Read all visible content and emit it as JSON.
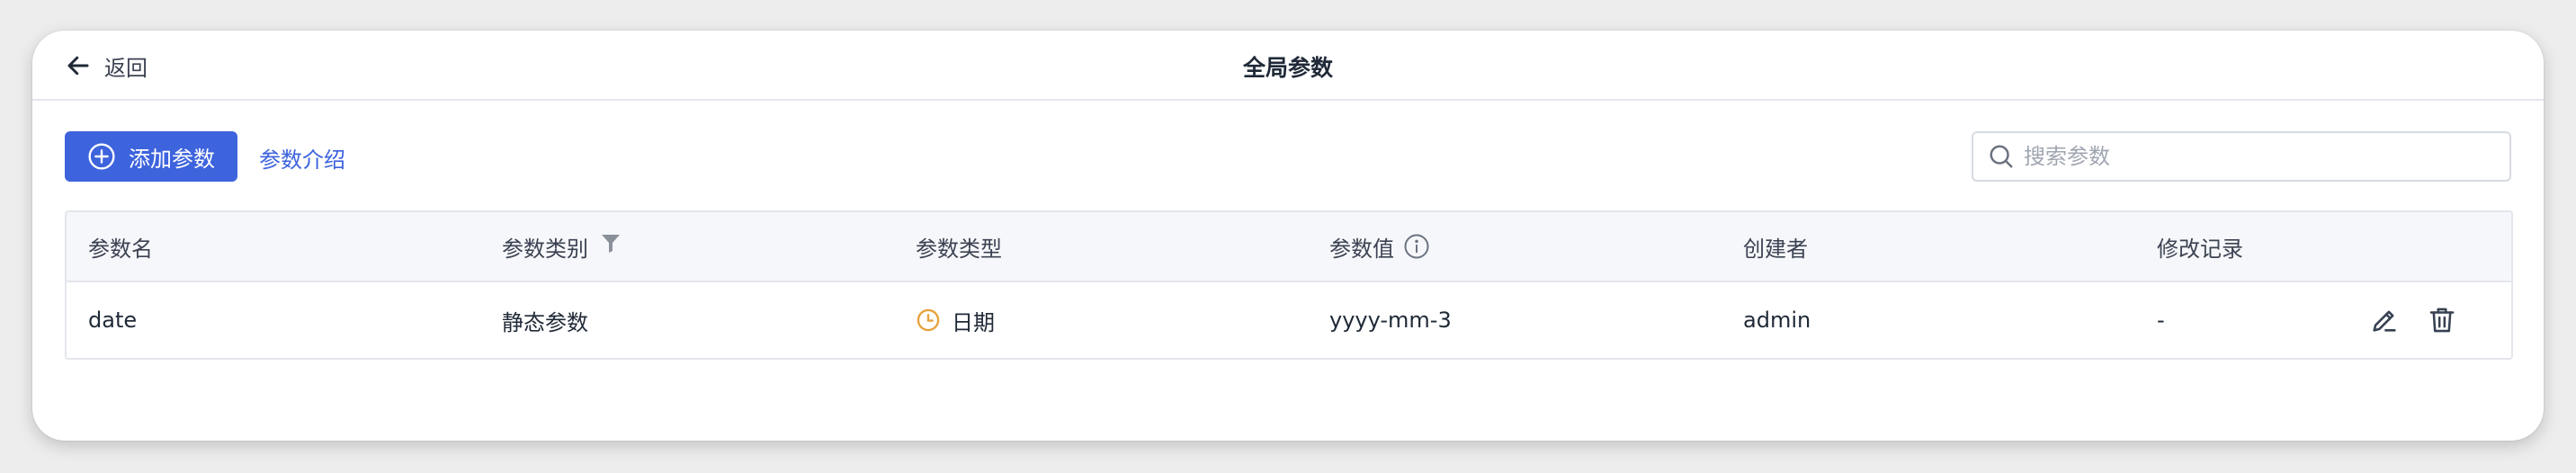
{
  "header": {
    "back_label": "返回",
    "title": "全局参数"
  },
  "toolbar": {
    "add_label": "添加参数",
    "intro_label": "参数介绍",
    "search_placeholder": "搜索参数",
    "search_value": ""
  },
  "table": {
    "columns": [
      {
        "label": "参数名"
      },
      {
        "label": "参数类别",
        "icon": "filter-icon"
      },
      {
        "label": "参数类型"
      },
      {
        "label": "参数值",
        "icon": "info-icon"
      },
      {
        "label": "创建者"
      },
      {
        "label": "修改记录"
      }
    ],
    "rows": [
      {
        "name": "date",
        "category": "静态参数",
        "type": "日期",
        "type_icon": "clock-icon",
        "value": "yyyy-mm-3",
        "creator": "admin",
        "history": "-",
        "actions": [
          "edit-icon",
          "trash-icon"
        ]
      }
    ]
  },
  "colors": {
    "primary": "#3d63dd",
    "type_icon": "#e6a23c",
    "border": "#e3e6ec",
    "header_bg": "#f6f7fa"
  }
}
